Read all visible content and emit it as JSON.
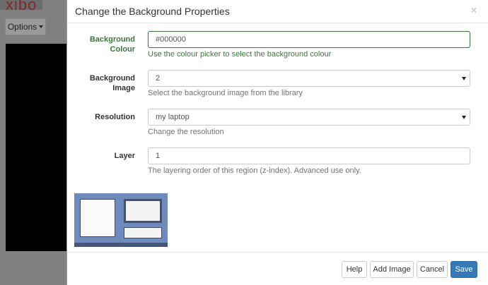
{
  "background": {
    "logo": "xibo",
    "options_label": "Options"
  },
  "modal": {
    "title": "Change the Background Properties",
    "close": "×",
    "fields": {
      "bg_colour": {
        "label": "Background Colour",
        "value": "#000000",
        "help": "Use the colour picker to select the background colour"
      },
      "bg_image": {
        "label": "Background Image",
        "value": "2",
        "help": "Select the background image from the library"
      },
      "resolution": {
        "label": "Resolution",
        "value": "my laptop",
        "help": "Change the resolution"
      },
      "layer": {
        "label": "Layer",
        "value": "1",
        "help": "The layering order of this region (z-index). Advanced use only."
      }
    },
    "footer": {
      "help": "Help",
      "add_image": "Add Image",
      "cancel": "Cancel",
      "save": "Save"
    }
  },
  "colors": {
    "success": "#3c763d",
    "primary": "#337ab7"
  }
}
